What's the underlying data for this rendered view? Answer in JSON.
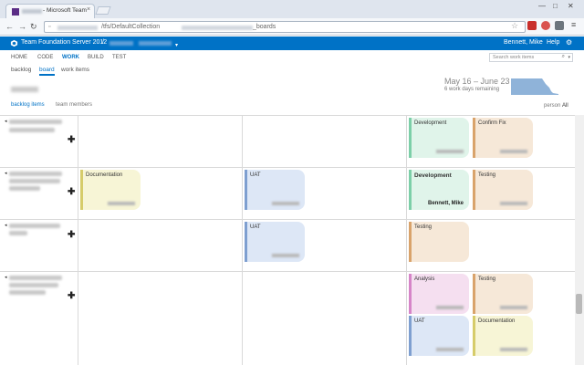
{
  "browser": {
    "tab_title": "- Microsoft Team",
    "tab_close": "×",
    "url_prefix": "/tfs/DefaultCollection",
    "url_suffix": "_boards",
    "win_minimize": "—",
    "win_maximize": "□",
    "win_close": "✕"
  },
  "app": {
    "product_name": "Team Foundation Server 2012",
    "crumb_separator": "/",
    "user_name": "Bennett, Mike",
    "help_label": "Help",
    "hubs": [
      "HOME",
      "CODE",
      "WORK",
      "BUILD",
      "TEST"
    ],
    "active_hub": "WORK",
    "search_placeholder": "Search work items",
    "subnav": [
      "backlog",
      "board",
      "work items"
    ],
    "active_subnav": "board"
  },
  "sprint": {
    "dates": "May 16 – June 23",
    "remaining": "6 work days remaining",
    "burndown_color": "#8fb3d9"
  },
  "board_view": {
    "tabs": [
      "backlog items",
      "team members"
    ],
    "active_tab": "backlog items",
    "person_label": "person",
    "person_value": "All"
  },
  "colors": {
    "development_bar": "#7ccfa8",
    "development_bg": "#e0f4ea",
    "confirm_bar": "#d9a36b",
    "confirm_bg": "#f6e8d8",
    "documentation_bar": "#d6cc6a",
    "documentation_bg": "#f7f5d6",
    "uat_bar": "#7e9fd0",
    "uat_bg": "#dde7f6",
    "testing_bar": "#d9a36b",
    "testing_bg": "#f6e8d8",
    "analysis_bar": "#d685c8",
    "analysis_bg": "#f5dff0"
  },
  "rows": [
    {
      "cards": [
        {
          "title": "Development",
          "type": "development",
          "assignee": ""
        },
        {
          "title": "Confirm Fix",
          "type": "confirm",
          "assignee": ""
        }
      ]
    },
    {
      "cards": [
        {
          "title": "Documentation",
          "type": "documentation",
          "assignee": ""
        },
        {
          "title": "UAT",
          "type": "uat",
          "assignee": ""
        },
        {
          "title": "Development",
          "type": "development",
          "assignee": "Bennett, Mike"
        },
        {
          "title": "Testing",
          "type": "testing",
          "assignee": ""
        }
      ]
    },
    {
      "cards": [
        {
          "title": "UAT",
          "type": "uat",
          "assignee": ""
        },
        {
          "title": "Testing",
          "type": "testing",
          "assignee": ""
        }
      ]
    },
    {
      "cards": [
        {
          "title": "Analysis",
          "type": "analysis",
          "assignee": ""
        },
        {
          "title": "Testing",
          "type": "testing",
          "assignee": ""
        },
        {
          "title": "UAT",
          "type": "uat",
          "assignee": ""
        },
        {
          "title": "Documentation",
          "type": "documentation",
          "assignee": ""
        }
      ]
    }
  ],
  "icons": {
    "back": "←",
    "forward": "→",
    "reload": "↻",
    "lock": "🔒",
    "star": "☆",
    "menu": "≡",
    "gear": "⚙",
    "search": "⌕",
    "chevron": "▾",
    "row_arrow": "◂",
    "plus": "✚"
  }
}
